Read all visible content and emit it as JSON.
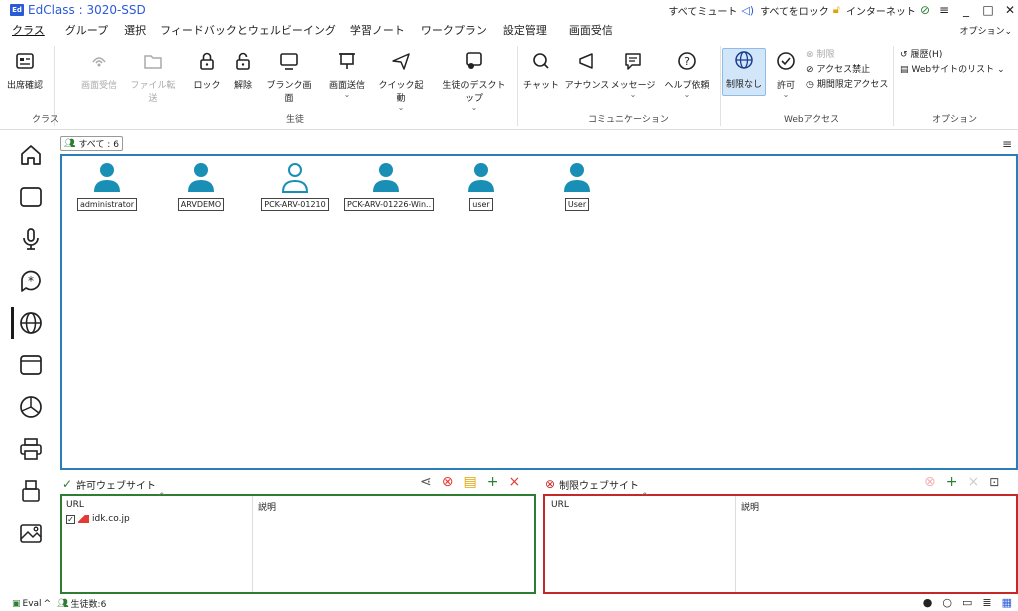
{
  "titlebar": {
    "logo_text": "Ed",
    "title": "EdClass : 3020-SSD",
    "mute_all": "すべてミュート",
    "lock_all": "すべてをロック",
    "internet": "インターネット"
  },
  "menubar": {
    "items": [
      "クラス",
      "グループ",
      "選択",
      "フィードバックとウェルビーイング",
      "学習ノート",
      "ワークプラン",
      "設定管理",
      "画面受信"
    ],
    "options": "オプション"
  },
  "ribbon": {
    "buttons": {
      "attendance": "出席確認",
      "receive_screen": "画面受信",
      "file_transfer": "ファイル転送",
      "lock": "ロック",
      "unlock": "解除",
      "blank_screen": "ブランク画面",
      "send_screen": "画面送信",
      "quick_launch": "クイック起動",
      "student_desktop": "生徒のデスクトップ",
      "chat": "チャット",
      "announce": "アナウンス",
      "message": "メッセージ",
      "help_request": "ヘルプ依頼",
      "no_limit": "制限なし",
      "allow": "許可"
    },
    "web_small": {
      "limit": "制限",
      "block_access": "アクセス禁止",
      "timed_access": "期間限定アクセス"
    },
    "options_small": {
      "history": "履歴(H)",
      "site_list": "Webサイトのリスト"
    },
    "groups": {
      "class": "クラス",
      "student": "生徒",
      "communication": "コミュニケーション",
      "web_access": "Webアクセス",
      "options": "オプション"
    }
  },
  "students": {
    "filter_tag": "すべて : 6",
    "items": [
      {
        "name": "administrator",
        "state": "filled"
      },
      {
        "name": "ARVDEMO",
        "state": "filled"
      },
      {
        "name": "PCK-ARV-01210",
        "state": "outline"
      },
      {
        "name": "PCK-ARV-01226-Win..",
        "state": "filled"
      },
      {
        "name": "user",
        "state": "filled"
      },
      {
        "name": "User",
        "state": "filled"
      }
    ]
  },
  "allowed_sites": {
    "title": "許可ウェブサイト",
    "col_url": "URL",
    "col_desc": "説明",
    "rows": [
      {
        "url": "idk.co.jp",
        "checked": true,
        "desc": ""
      }
    ]
  },
  "blocked_sites": {
    "title": "制限ウェブサイト",
    "col_url": "URL",
    "col_desc": "説明"
  },
  "statusbar": {
    "eval": "Eval",
    "student_count": "生徒数:6"
  },
  "colors": {
    "accent": "#2a5bd7",
    "student_teal": "#1a8fb5",
    "allow_green": "#2f7d32",
    "deny_red": "#c62828"
  }
}
